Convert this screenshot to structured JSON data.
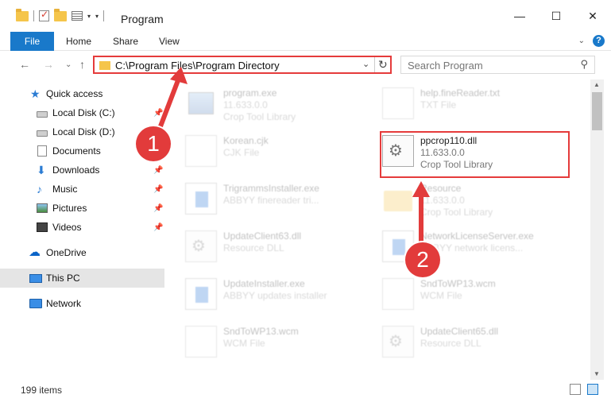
{
  "window": {
    "title": "Program",
    "minimize": "—",
    "maximize": "☐",
    "close": "✕"
  },
  "ribbon": {
    "tabs": [
      "File",
      "Home",
      "Share",
      "View"
    ],
    "expand": "⌄",
    "help": "?"
  },
  "nav": {
    "back": "←",
    "forward": "→",
    "recent": "⌄",
    "up": "↑",
    "address": "C:\\Program Files\\Program Directory",
    "refresh": "↻",
    "search_placeholder": "Search Program"
  },
  "sidebar": {
    "items": [
      {
        "label": "Quick access",
        "icon": "star-icon"
      },
      {
        "label": "Local Disk (C:)",
        "icon": "disk-icon"
      },
      {
        "label": "Local Disk (D:)",
        "icon": "disk-icon"
      },
      {
        "label": "Documents",
        "icon": "document-icon"
      },
      {
        "label": "Downloads",
        "icon": "download-icon"
      },
      {
        "label": "Music",
        "icon": "music-icon"
      },
      {
        "label": "Pictures",
        "icon": "picture-icon"
      },
      {
        "label": "Videos",
        "icon": "video-icon"
      },
      {
        "label": "OneDrive",
        "icon": "cloud-icon"
      },
      {
        "label": "This PC",
        "icon": "computer-icon"
      },
      {
        "label": "Network",
        "icon": "network-icon"
      }
    ],
    "selected": "This PC"
  },
  "files": [
    {
      "name": "program.exe",
      "type": "11.633.0.0",
      "desc": "Crop Tool Library"
    },
    {
      "name": "help.fineReader.txt",
      "type": "TXT File",
      "desc": ""
    },
    {
      "name": "Korean.cjk",
      "type": "CJK File",
      "desc": ""
    },
    {
      "name": "ppcrop110.dll",
      "type": "11.633.0.0",
      "desc": "Crop Tool Library"
    },
    {
      "name": "TrigrammsInstaller.exe",
      "type": "ABBYY finereader tri...",
      "desc": ""
    },
    {
      "name": "Resource",
      "type": "11.633.0.0",
      "desc": "Crop Tool Library"
    },
    {
      "name": "UpdateClient63.dll",
      "type": "Resource DLL",
      "desc": ""
    },
    {
      "name": "NetworkLicenseServer.exe",
      "type": "ABBYY network licens...",
      "desc": ""
    },
    {
      "name": "UpdateInstaller.exe",
      "type": "ABBYY updates installer",
      "desc": ""
    },
    {
      "name": "SndToWP13.wcm",
      "type": "WCM File",
      "desc": ""
    },
    {
      "name": "SndToWP13.wcm",
      "type": "WCM File",
      "desc": ""
    },
    {
      "name": "UpdateClient65.dll",
      "type": "Resource DLL",
      "desc": ""
    }
  ],
  "callouts": [
    "1",
    "2"
  ],
  "status": {
    "items_count": "199 items"
  },
  "colors": {
    "accent": "#1979ca",
    "highlight": "#e53b3b"
  }
}
